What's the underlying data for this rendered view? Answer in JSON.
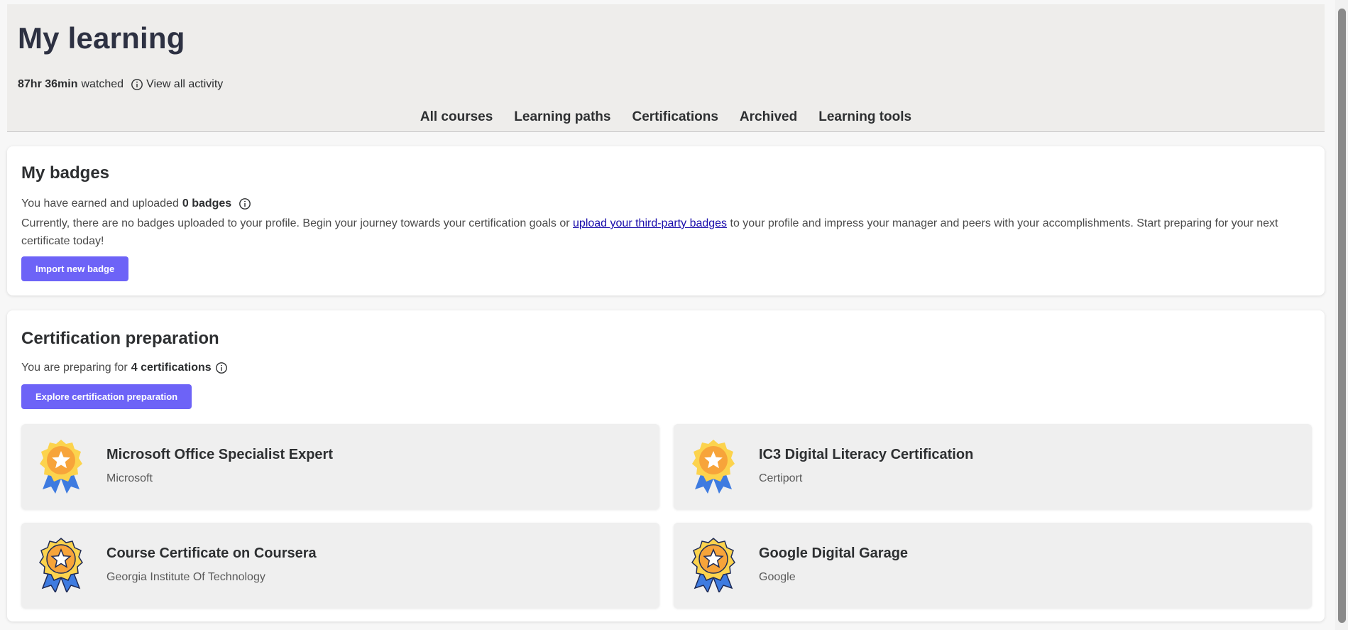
{
  "header": {
    "title": "My learning",
    "watched_time": "87hr 36min",
    "watched_suffix": "watched",
    "view_all_activity": "View all activity",
    "tabs": [
      "All courses",
      "Learning paths",
      "Certifications",
      "Archived",
      "Learning tools"
    ]
  },
  "badges": {
    "heading": "My badges",
    "summary_prefix": "You have earned and uploaded",
    "summary_count": "0 badges",
    "description_before": "Currently, there are no badges uploaded to your profile. Begin your journey towards your certification goals or ",
    "description_link": "upload your third-party badges",
    "description_after": " to your profile and impress your manager and peers with your accomplishments. Start preparing for your next certificate today!",
    "button_label": "Import new badge"
  },
  "certification": {
    "heading": "Certification preparation",
    "summary_prefix": "You are preparing for",
    "summary_count": "4 certifications",
    "button_label": "Explore certification preparation",
    "items": [
      {
        "name": "Microsoft Office Specialist Expert",
        "issuer": "Microsoft",
        "icon": "medal-ribbon-icon"
      },
      {
        "name": "IC3 Digital Literacy Certification",
        "issuer": "Certiport",
        "icon": "medal-ribbon-icon"
      },
      {
        "name": "Course Certificate on Coursera",
        "issuer": "Georgia Institute Of Technology",
        "icon": "medal-badge-icon"
      },
      {
        "name": "Google Digital Garage",
        "issuer": "Google",
        "icon": "medal-badge-icon"
      }
    ]
  },
  "colors": {
    "primary_button": "#6d63f7",
    "header_bg": "#eeedeb",
    "link": "#1a0dab"
  }
}
